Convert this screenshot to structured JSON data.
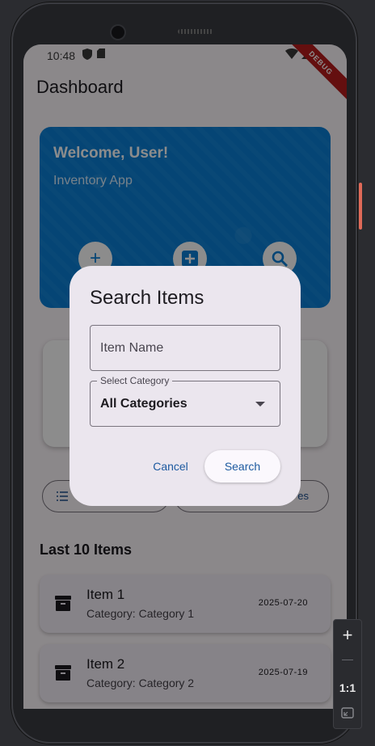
{
  "status_bar": {
    "time": "10:48",
    "debug_label": "DEBUG"
  },
  "app_bar": {
    "title": "Dashboard"
  },
  "welcome_card": {
    "title": "Welcome, User!",
    "subtitle": "Inventory App",
    "actions": [
      {
        "icon": "add-icon"
      },
      {
        "icon": "add-box-icon"
      },
      {
        "icon": "search-icon"
      }
    ]
  },
  "filter_chips": [
    {
      "icon": "list-icon",
      "label": ""
    },
    {
      "label": "es"
    }
  ],
  "recent": {
    "title": "Last 10 Items",
    "items": [
      {
        "name": "Item 1",
        "category": "Category: Category 1",
        "date": "2025-07-20"
      },
      {
        "name": "Item 2",
        "category": "Category: Category 2",
        "date": "2025-07-19"
      }
    ]
  },
  "dialog": {
    "title": "Search Items",
    "item_name_placeholder": "Item Name",
    "category_label": "Select Category",
    "category_value": "All Categories",
    "cancel_label": "Cancel",
    "search_label": "Search"
  },
  "zoom_panel": {
    "plus": "+",
    "minus": "—",
    "ratio": "1:1"
  },
  "colors": {
    "card_blue": "#0a7fd6",
    "primary_text_button": "#1d5aa0",
    "debug_red": "#b71c1c"
  }
}
